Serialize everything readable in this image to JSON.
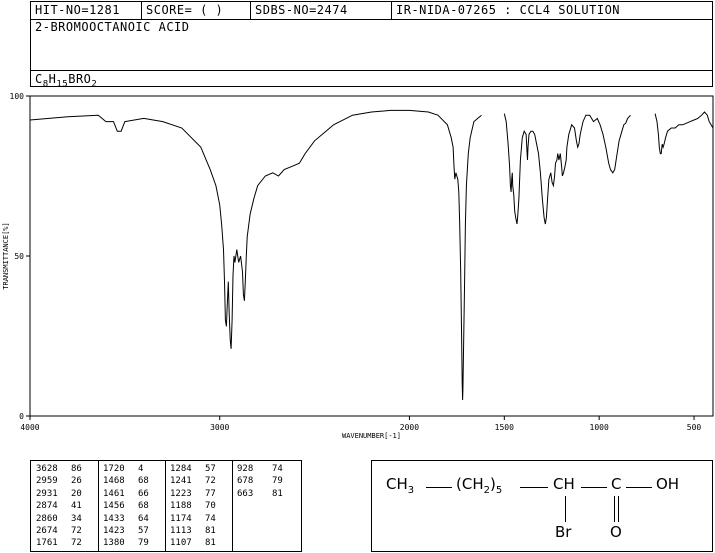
{
  "header": {
    "hit_no": "HIT-NO=1281",
    "score": "SCORE=  (  )",
    "sdbs_no": "SDBS-NO=2474",
    "ir_info": "IR-NIDA-07265 : CCL4 SOLUTION",
    "compound_name": "2-BROMOOCTANOIC ACID",
    "formula": {
      "c": "C",
      "c_n": "8",
      "h": "H",
      "h_n": "15",
      "rest": "BRO",
      "o_n": "2"
    }
  },
  "chart_data": {
    "type": "line",
    "xlabel": "WAVENUMBER[-1]",
    "ylabel": "TRANSMITTANCE[%]",
    "xlim": [
      4000,
      400
    ],
    "ylim": [
      0,
      100
    ],
    "x_ticks": [
      4000,
      3000,
      2000,
      1500,
      1000,
      500
    ],
    "y_ticks": [
      0,
      50,
      100
    ],
    "segments": [
      [
        [
          4000,
          92.5
        ],
        [
          3800,
          93.5
        ],
        [
          3640,
          94
        ],
        [
          3600,
          92
        ],
        [
          3560,
          92
        ],
        [
          3540,
          89
        ],
        [
          3520,
          89
        ],
        [
          3500,
          92
        ],
        [
          3400,
          93
        ],
        [
          3300,
          92
        ],
        [
          3200,
          90
        ],
        [
          3100,
          84
        ],
        [
          3050,
          77
        ],
        [
          3020,
          72
        ],
        [
          3000,
          66
        ],
        [
          2990,
          60
        ],
        [
          2980,
          52
        ],
        [
          2975,
          42
        ],
        [
          2970,
          30
        ],
        [
          2965,
          28
        ],
        [
          2960,
          35
        ],
        [
          2955,
          42
        ],
        [
          2950,
          32
        ],
        [
          2945,
          24
        ],
        [
          2940,
          21
        ],
        [
          2935,
          30
        ],
        [
          2930,
          44
        ],
        [
          2925,
          50
        ],
        [
          2920,
          48
        ],
        [
          2910,
          52
        ],
        [
          2900,
          48
        ],
        [
          2890,
          50
        ],
        [
          2880,
          45
        ],
        [
          2875,
          38
        ],
        [
          2870,
          36
        ],
        [
          2865,
          42
        ],
        [
          2860,
          50
        ],
        [
          2855,
          56
        ],
        [
          2840,
          63
        ],
        [
          2820,
          68
        ],
        [
          2800,
          72
        ],
        [
          2760,
          75
        ],
        [
          2720,
          76
        ],
        [
          2690,
          75
        ],
        [
          2660,
          77
        ],
        [
          2620,
          78
        ],
        [
          2580,
          79
        ],
        [
          2550,
          82
        ],
        [
          2500,
          86
        ],
        [
          2400,
          91
        ],
        [
          2300,
          94
        ],
        [
          2200,
          95
        ],
        [
          2100,
          95.5
        ],
        [
          2000,
          95.5
        ],
        [
          1900,
          95
        ],
        [
          1850,
          94
        ],
        [
          1800,
          91
        ],
        [
          1780,
          87
        ],
        [
          1770,
          84
        ],
        [
          1765,
          78
        ],
        [
          1761,
          74
        ],
        [
          1755,
          76
        ],
        [
          1745,
          74
        ],
        [
          1740,
          70
        ],
        [
          1735,
          60
        ],
        [
          1730,
          45
        ],
        [
          1725,
          25
        ],
        [
          1722,
          10
        ],
        [
          1720,
          5
        ],
        [
          1718,
          8
        ],
        [
          1715,
          20
        ],
        [
          1710,
          40
        ],
        [
          1705,
          60
        ],
        [
          1700,
          72
        ],
        [
          1690,
          82
        ],
        [
          1680,
          87
        ],
        [
          1660,
          92
        ],
        [
          1640,
          93
        ],
        [
          1620,
          94
        ]
      ],
      [
        [
          1500,
          94.5
        ],
        [
          1490,
          92
        ],
        [
          1480,
          85
        ],
        [
          1472,
          78
        ],
        [
          1468,
          72
        ],
        [
          1464,
          70
        ],
        [
          1461,
          74
        ],
        [
          1458,
          76
        ],
        [
          1456,
          72
        ],
        [
          1450,
          69
        ],
        [
          1445,
          64
        ],
        [
          1440,
          62
        ],
        [
          1433,
          60
        ],
        [
          1430,
          62
        ],
        [
          1425,
          66
        ],
        [
          1423,
          68
        ],
        [
          1415,
          80
        ],
        [
          1405,
          87
        ],
        [
          1395,
          89
        ],
        [
          1385,
          88
        ],
        [
          1380,
          82
        ],
        [
          1378,
          80
        ],
        [
          1375,
          84
        ],
        [
          1370,
          88
        ],
        [
          1360,
          89
        ],
        [
          1350,
          89
        ],
        [
          1340,
          88
        ],
        [
          1320,
          82
        ],
        [
          1310,
          76
        ],
        [
          1300,
          68
        ],
        [
          1290,
          62
        ],
        [
          1284,
          60
        ],
        [
          1278,
          62
        ],
        [
          1272,
          68
        ],
        [
          1265,
          74
        ],
        [
          1255,
          76
        ],
        [
          1248,
          73
        ],
        [
          1241,
          72
        ],
        [
          1235,
          75
        ],
        [
          1230,
          79
        ],
        [
          1223,
          80
        ],
        [
          1218,
          82
        ],
        [
          1212,
          80
        ],
        [
          1205,
          82
        ],
        [
          1198,
          78
        ],
        [
          1194,
          75
        ],
        [
          1188,
          76
        ],
        [
          1180,
          78
        ],
        [
          1174,
          80
        ],
        [
          1170,
          84
        ],
        [
          1160,
          88
        ],
        [
          1145,
          91
        ],
        [
          1130,
          90
        ],
        [
          1120,
          86
        ],
        [
          1113,
          84
        ],
        [
          1107,
          85
        ],
        [
          1100,
          88
        ],
        [
          1085,
          92
        ],
        [
          1070,
          94
        ],
        [
          1050,
          94
        ],
        [
          1030,
          92
        ],
        [
          1010,
          93
        ],
        [
          995,
          91
        ],
        [
          980,
          88
        ],
        [
          965,
          84
        ],
        [
          950,
          79
        ],
        [
          940,
          77
        ],
        [
          928,
          76
        ],
        [
          918,
          77
        ],
        [
          908,
          81
        ],
        [
          895,
          86
        ],
        [
          880,
          89
        ],
        [
          870,
          91
        ],
        [
          860,
          91.5
        ],
        [
          850,
          93
        ],
        [
          835,
          94
        ]
      ],
      [
        [
          705,
          94.5
        ],
        [
          695,
          92
        ],
        [
          688,
          88
        ],
        [
          683,
          84
        ],
        [
          678,
          82
        ],
        [
          673,
          82
        ],
        [
          668,
          85
        ],
        [
          663,
          84
        ],
        [
          658,
          85
        ],
        [
          650,
          87
        ],
        [
          640,
          89
        ],
        [
          620,
          90
        ],
        [
          600,
          90
        ],
        [
          580,
          91
        ],
        [
          560,
          91
        ],
        [
          540,
          91.5
        ],
        [
          520,
          92
        ],
        [
          500,
          92.5
        ],
        [
          480,
          93
        ],
        [
          460,
          94
        ],
        [
          445,
          95
        ],
        [
          430,
          94
        ],
        [
          420,
          92
        ],
        [
          410,
          91
        ],
        [
          400,
          90
        ]
      ]
    ]
  },
  "peaks": {
    "columns": [
      [
        [
          "3628",
          "86"
        ],
        [
          "2959",
          "26"
        ],
        [
          "2931",
          "20"
        ],
        [
          "2874",
          "41"
        ],
        [
          "2860",
          "34"
        ],
        [
          "2674",
          "72"
        ],
        [
          "1761",
          "72"
        ]
      ],
      [
        [
          "1720",
          "4"
        ],
        [
          "1468",
          "68"
        ],
        [
          "1461",
          "66"
        ],
        [
          "1456",
          "68"
        ],
        [
          "1433",
          "64"
        ],
        [
          "1423",
          "57"
        ],
        [
          "1380",
          "79"
        ]
      ],
      [
        [
          "1284",
          "57"
        ],
        [
          "1241",
          "72"
        ],
        [
          "1223",
          "77"
        ],
        [
          "1188",
          "70"
        ],
        [
          "1174",
          "74"
        ],
        [
          "1113",
          "81"
        ],
        [
          "1107",
          "81"
        ]
      ],
      [
        [
          "928",
          "74"
        ],
        [
          "678",
          "79"
        ],
        [
          "663",
          "81"
        ]
      ]
    ]
  },
  "structure": {
    "ch3": "CH",
    "ch3_n": "3",
    "chain": "(CH",
    "chain_n": "2",
    "chain_close": ")",
    "chain_rep": "5",
    "ch": "CH",
    "c": "C",
    "oh": "OH",
    "br": "Br",
    "o": "O"
  }
}
